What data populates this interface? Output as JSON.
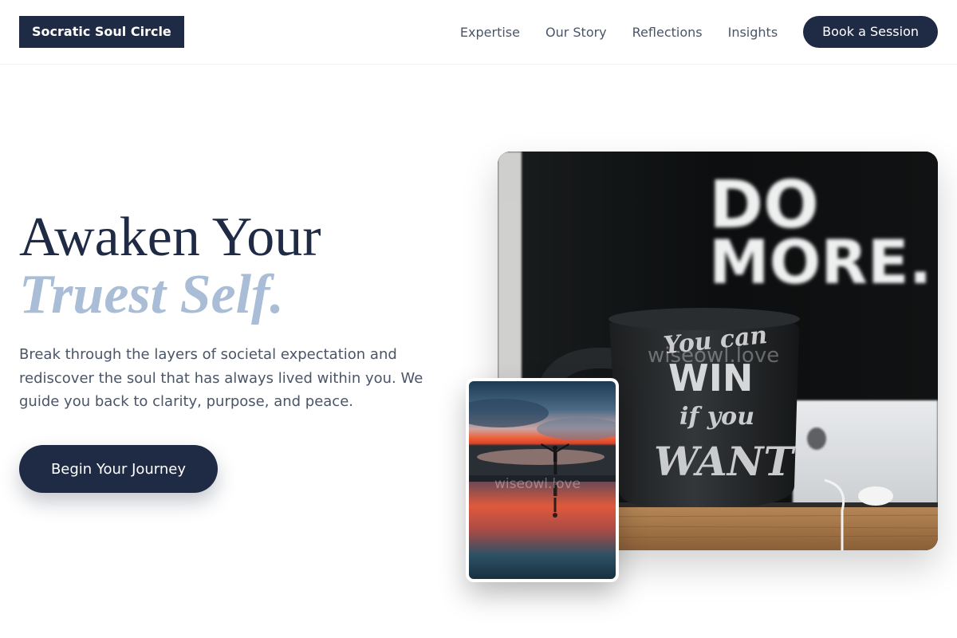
{
  "brand": {
    "name": "Socratic Soul Circle"
  },
  "nav": {
    "links": [
      "Expertise",
      "Our Story",
      "Reflections",
      "Insights"
    ],
    "cta": "Book a Session"
  },
  "hero": {
    "title_line1": "Awaken Your",
    "title_line2": "Truest Self.",
    "description": "Break through the layers of societal expectation and rediscover the soul that has always lived within you. We guide you back to clarity, purpose, and peace.",
    "cta": "Begin Your Journey"
  },
  "images": {
    "main": {
      "sign_text_1": "DO",
      "sign_text_2": "MORE.",
      "mug_line_1": "You can",
      "mug_line_2": "WIN",
      "mug_line_3": "if you",
      "mug_line_4": "WANT",
      "watermark": "wiseowl.love"
    },
    "small": {
      "watermark": "wiseowl.love"
    }
  },
  "colors": {
    "primary": "#1f2a44",
    "accent": "#a9bdd6",
    "body_text": "#4a5568"
  }
}
